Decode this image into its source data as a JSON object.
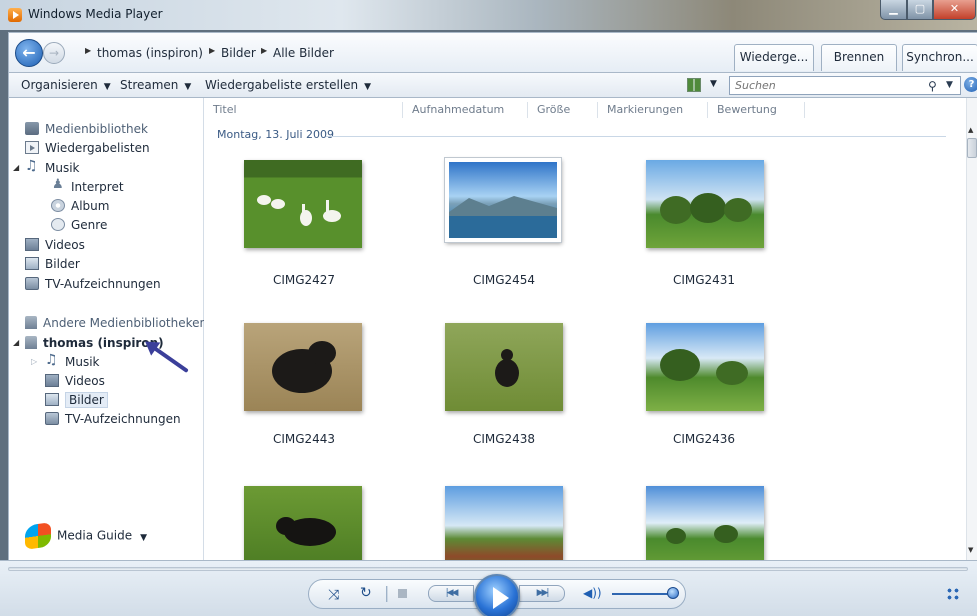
{
  "window": {
    "title": "Windows Media Player"
  },
  "nav": {
    "breadcrumb": [
      "thomas (inspiron)",
      "Bilder",
      "Alle Bilder"
    ],
    "tabs": [
      "Wiederge...",
      "Brennen",
      "Synchron..."
    ]
  },
  "toolbar": {
    "organize": "Organisieren",
    "stream": "Streamen",
    "create_playlist": "Wiedergabeliste erstellen",
    "search_placeholder": "Suchen"
  },
  "sidebar": {
    "library": "Medienbibliothek",
    "playlists": "Wiedergabelisten",
    "music": "Musik",
    "artist": "Interpret",
    "album": "Album",
    "genre": "Genre",
    "videos": "Videos",
    "pictures": "Bilder",
    "tv": "TV-Aufzeichnungen",
    "other_libraries": "Andere Medienbibliotheken",
    "remote_library": "thomas (inspiron)",
    "remote_music": "Musik",
    "remote_videos": "Videos",
    "remote_pictures": "Bilder",
    "remote_tv": "TV-Aufzeichnungen",
    "media_guide": "Media Guide"
  },
  "columns": [
    "Titel",
    "Aufnahmedatum",
    "Größe",
    "Markierungen",
    "Bewertung"
  ],
  "group_title": "Montag, 13. Juli 2009",
  "photos": [
    {
      "label": "CIMG2427",
      "icon": "geese-photo"
    },
    {
      "label": "CIMG2454",
      "icon": "lake-photo"
    },
    {
      "label": "CIMG2431",
      "icon": "trees-photo"
    },
    {
      "label": "CIMG2443",
      "icon": "dog-photo"
    },
    {
      "label": "CIMG2438",
      "icon": "dog-meadow-photo"
    },
    {
      "label": "CIMG2436",
      "icon": "tree-meadow-photo"
    },
    {
      "label": "",
      "icon": "dog-grass-photo"
    },
    {
      "label": "",
      "icon": "field-photo"
    },
    {
      "label": "",
      "icon": "meadow-photo"
    }
  ],
  "player": {
    "volume_level": 0.95
  },
  "colors": {
    "accent": "#2a73d6",
    "arrow": "#3b3f9a"
  }
}
